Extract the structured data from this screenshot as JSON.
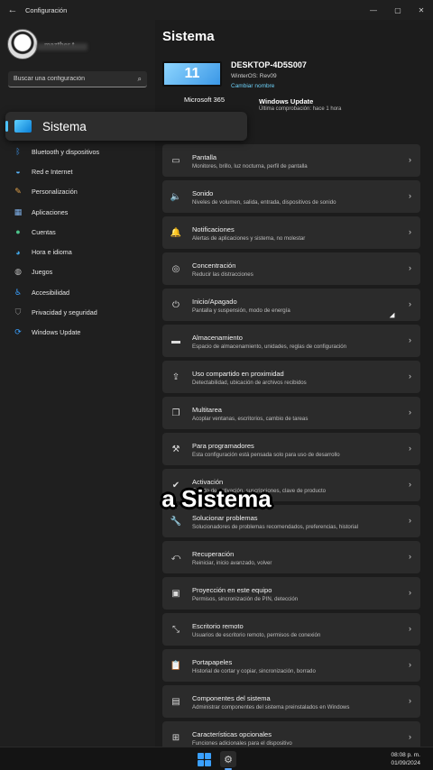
{
  "window": {
    "title": "Configuración",
    "back_icon": "back-arrow-icon",
    "controls": [
      "minimize-icon",
      "maximize-icon",
      "close-icon"
    ]
  },
  "profile": {
    "name": "mazther t."
  },
  "search": {
    "placeholder": "Buscar una configuración",
    "icon": "search-icon"
  },
  "selected": {
    "label": "Sistema",
    "icon": "system-icon"
  },
  "nav": [
    {
      "label": "Bluetooth y dispositivos",
      "icon": "bluetooth-icon"
    },
    {
      "label": "Red e Internet",
      "icon": "wifi-icon"
    },
    {
      "label": "Personalización",
      "icon": "brush-icon"
    },
    {
      "label": "Aplicaciones",
      "icon": "apps-icon"
    },
    {
      "label": "Cuentas",
      "icon": "person-icon"
    },
    {
      "label": "Hora e idioma",
      "icon": "globe-clock-icon"
    },
    {
      "label": "Juegos",
      "icon": "gamepad-icon"
    },
    {
      "label": "Accesibilidad",
      "icon": "accessibility-icon"
    },
    {
      "label": "Privacidad y seguridad",
      "icon": "shield-icon"
    },
    {
      "label": "Windows Update",
      "icon": "update-icon"
    }
  ],
  "main": {
    "title": "Sistema",
    "device": {
      "name": "DESKTOP-4D5S007",
      "os": "WinterOS: Rev09",
      "rename": "Cambiar nombre"
    },
    "tiles": {
      "microsoft": "Microsoft 365",
      "update_title": "Windows Update",
      "update_sub": "Última comprobación: hace 1 hora"
    },
    "rows": [
      {
        "title": "Pantalla",
        "sub": "Monitores, brillo, luz nocturna, perfil de pantalla",
        "icon": "display-icon"
      },
      {
        "title": "Sonido",
        "sub": "Niveles de volumen, salida, entrada, dispositivos de sonido",
        "icon": "speaker-icon"
      },
      {
        "title": "Notificaciones",
        "sub": "Alertas de aplicaciones y sistema, no molestar",
        "icon": "bell-icon"
      },
      {
        "title": "Concentración",
        "sub": "Reducir las distracciones",
        "icon": "focus-icon"
      },
      {
        "title": "Inicio/Apagado",
        "sub": "Pantalla y suspensión, modo de energía",
        "icon": "power-icon"
      },
      {
        "title": "Almacenamiento",
        "sub": "Espacio de almacenamiento, unidades, reglas de configuración",
        "icon": "storage-icon"
      },
      {
        "title": "Uso compartido en proximidad",
        "sub": "Detectabilidad, ubicación de archivos recibidos",
        "icon": "share-icon"
      },
      {
        "title": "Multitarea",
        "sub": "Acoplar ventanas, escritorios, cambio de tareas",
        "icon": "multitask-icon"
      },
      {
        "title": "Para programadores",
        "sub": "Esta configuración está pensada solo para uso de desarrollo",
        "icon": "developer-icon"
      },
      {
        "title": "Activación",
        "sub": "Estado de activación, suscripciones, clave de producto",
        "icon": "activation-icon"
      },
      {
        "title": "Solucionar problemas",
        "sub": "Solucionadores de problemas recomendados, preferencias, historial",
        "icon": "wrench-icon"
      },
      {
        "title": "Recuperación",
        "sub": "Reiniciar, inicio avanzado, volver",
        "icon": "recovery-icon"
      },
      {
        "title": "Proyección en este equipo",
        "sub": "Permisos, sincronización de PIN, detección",
        "icon": "projection-icon"
      },
      {
        "title": "Escritorio remoto",
        "sub": "Usuarios de escritorio remoto, permisos de conexión",
        "icon": "remote-desktop-icon"
      },
      {
        "title": "Portapapeles",
        "sub": "Historial de cortar y copiar, sincronización, borrado",
        "icon": "clipboard-icon"
      },
      {
        "title": "Componentes del sistema",
        "sub": "Administrar componentes del sistema preinstalados en Windows",
        "icon": "components-icon"
      },
      {
        "title": "Características opcionales",
        "sub": "Funciones adicionales para el dispositivo",
        "icon": "optional-features-icon"
      }
    ]
  },
  "caption": "a Sistema",
  "taskbar": {
    "time": "08:08 p. m.",
    "date": "01/09/2024",
    "start_icon": "windows-start-icon",
    "settings_icon": "settings-gear-icon"
  }
}
